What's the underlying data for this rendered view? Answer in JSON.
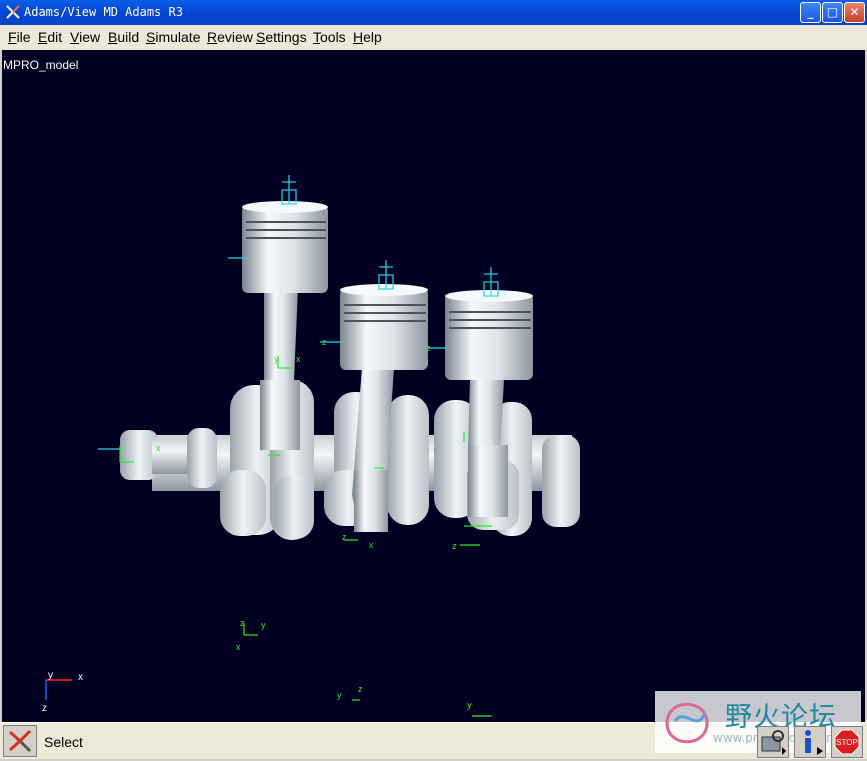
{
  "window": {
    "title": "Adams/View MD Adams R3"
  },
  "window_buttons": {
    "minimize": "_",
    "maximize": "□",
    "close": "✕"
  },
  "menu": [
    "File",
    "Edit",
    "View",
    "Build",
    "Simulate",
    "Review",
    "Settings",
    "Tools",
    "Help"
  ],
  "viewport": {
    "model_name": "MPRO_model",
    "background": "#020022"
  },
  "triad": {
    "x": "x",
    "y": "y",
    "z": "z"
  },
  "markers": {
    "x": "x",
    "y": "y",
    "z": "z"
  },
  "status": {
    "text": "Select"
  },
  "toolbar_icons": [
    "select-arrow-icon",
    "tools-icon",
    "info-icon",
    "stop-icon"
  ],
  "stop_label": "STOP",
  "watermark": {
    "text": "野火论坛",
    "url": "www.proewildfire.cn"
  },
  "colors": {
    "marker": "#22ee22",
    "joint": "#22d8e8",
    "part": "#dde3e8",
    "titlebar": "#0a5ee8"
  }
}
